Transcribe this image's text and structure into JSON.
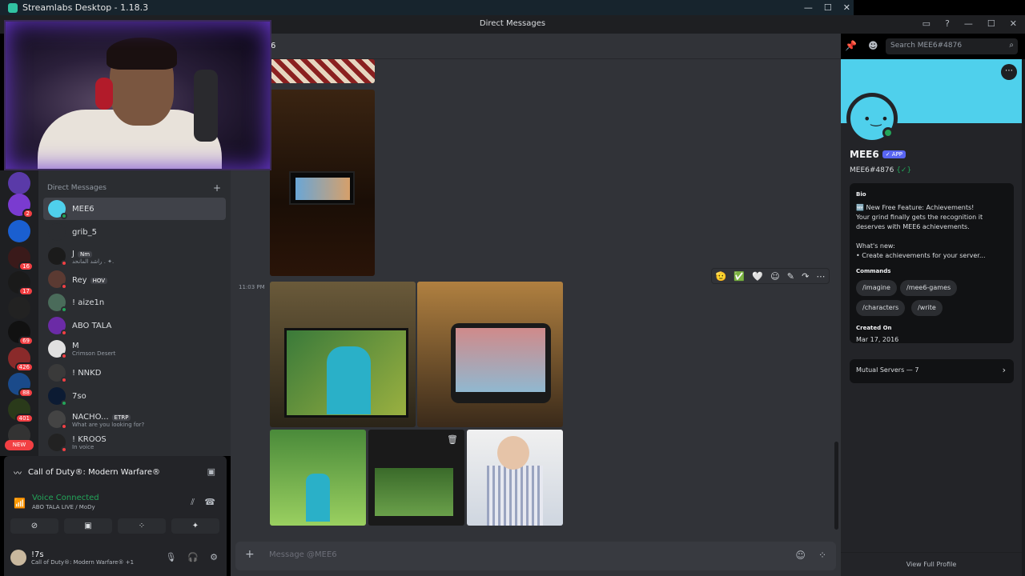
{
  "streamlabs": {
    "title": "Streamlabs Desktop - 1.18.3"
  },
  "discord": {
    "window_title": "Direct Messages",
    "chat_header": "6"
  },
  "search": {
    "placeholder": "Search MEE6#4876"
  },
  "sidebar": {
    "header": "Direct Messages",
    "items": [
      {
        "name": "MEE6",
        "sub": "",
        "tag": "",
        "color": "#4fd0ec",
        "status": "#23a559"
      },
      {
        "name": "grib_5",
        "sub": "",
        "tag": "",
        "color": "#2b2d31",
        "status": ""
      },
      {
        "name": "J",
        "sub": "راشد المانحد . ✦.",
        "tag": "Nm",
        "color": "#1b1b1b",
        "status": "#f23f43"
      },
      {
        "name": "Rey",
        "sub": "",
        "tag": "HOV",
        "color": "#5b3a32",
        "status": "#f23f43"
      },
      {
        "name": "! aize1n",
        "sub": "",
        "tag": "",
        "color": "#4a6b5a",
        "status": "#23a559"
      },
      {
        "name": "ABO TALA",
        "sub": "",
        "tag": "",
        "color": "#6b2ba6",
        "status": "#f23f43"
      },
      {
        "name": "M",
        "sub": "Crimson Desert",
        "tag": "",
        "color": "#e0e0e0",
        "status": "#f23f43"
      },
      {
        "name": "! NNKD",
        "sub": "",
        "tag": "",
        "color": "#3a3a3a",
        "status": "#f23f43"
      },
      {
        "name": "7so",
        "sub": "",
        "tag": "",
        "color": "#0c1b33",
        "status": "#23a559"
      },
      {
        "name": "NACHO...",
        "sub": "What are you looking for?",
        "tag": "ETRP",
        "color": "#444",
        "status": "#f23f43"
      },
      {
        "name": "! KROOS",
        "sub": "In voice",
        "tag": "",
        "color": "#222",
        "status": "#f23f43"
      }
    ]
  },
  "rail": {
    "badges": [
      "2",
      "16",
      "17",
      "69",
      "426",
      "88",
      "401"
    ],
    "new_label": "NEW"
  },
  "voice": {
    "game": "Call of Duty®: Modern Warfare®",
    "status": "Voice Connected",
    "channel": "ABO TALA LIVE / MoDy"
  },
  "user": {
    "name": "!7s",
    "status": "Call of Duty®: Modern Warfare® +1"
  },
  "chat": {
    "time": "11:03 PM",
    "composer_placeholder": "Message @MEE6"
  },
  "profile": {
    "name": "MEE6",
    "app_badge": "✓ APP",
    "tag": "MEE6#4876",
    "tag_suffix": "{✓}",
    "bio_label": "Bio",
    "bio_line1": "🆕 New Free Feature: Achievements!",
    "bio_line2": "Your grind finally gets the recognition it deserves with MEE6 achievements.",
    "bio_line3": "What's new:",
    "bio_line4": "• Create achievements for your server...",
    "commands_label": "Commands",
    "commands": [
      "/imagine",
      "/mee6-games",
      "/characters",
      "/write"
    ],
    "created_label": "Created On",
    "created_value": "Mar 17, 2016",
    "mutual": "Mutual Servers — 7",
    "footer": "View Full Profile"
  },
  "colors": {
    "accent": "#5865f2",
    "online": "#23a559",
    "dnd": "#f23f43",
    "mee6_blue": "#4fd0ec"
  }
}
